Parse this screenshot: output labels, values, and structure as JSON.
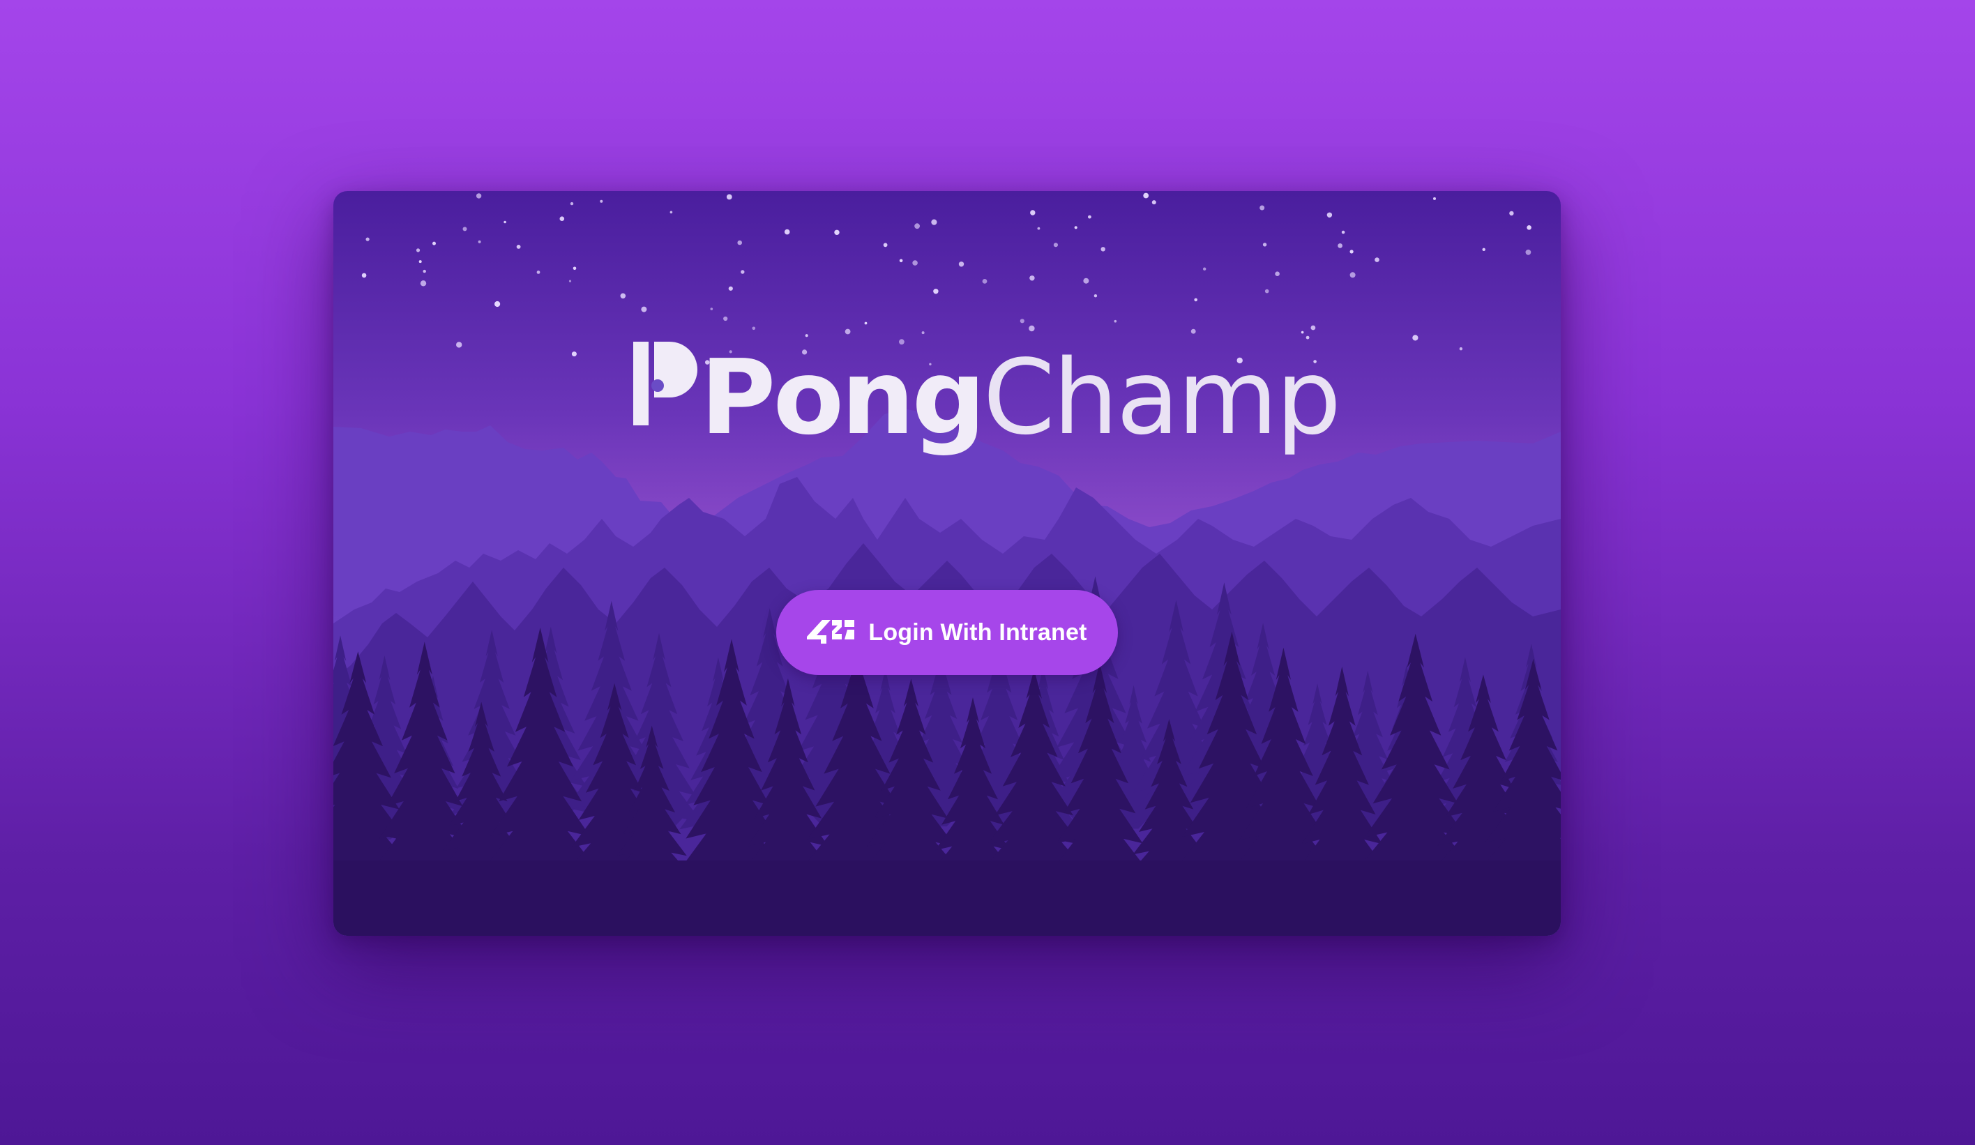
{
  "app": {
    "title_bold": "Pong",
    "title_light": "Champ"
  },
  "login": {
    "label": "Login With Intranet",
    "icon": "42-logo-icon"
  },
  "colors": {
    "page_top": "#a445ea",
    "page_bottom": "#4e1796",
    "button": "#a646ea",
    "sky_top": "#4a1e9e",
    "sky_bottom": "#b66ddb",
    "forest_dark": "#2b105f"
  }
}
